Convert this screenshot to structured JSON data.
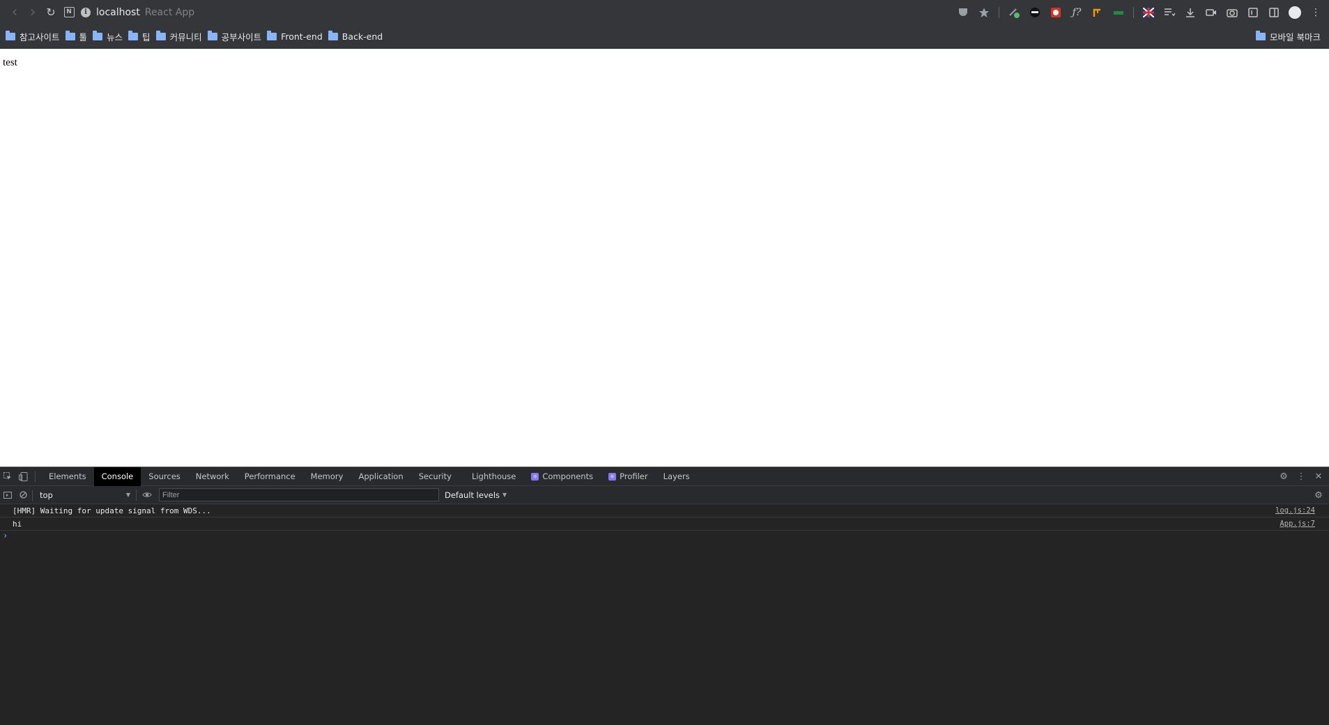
{
  "browser": {
    "nav": {
      "back_icon": "‹",
      "forward_icon": "›",
      "reload_icon": "↻",
      "ext_label": "N"
    },
    "omnibox": {
      "host": "localhost",
      "page_title": "React App",
      "info_glyph": "i"
    }
  },
  "bookmarks": {
    "items": [
      "참고사이트",
      "툴",
      "뉴스",
      "팁",
      "커뮤니티",
      "공부사이트",
      "Front-end",
      "Back-end"
    ],
    "mobile": "모바일 북마크"
  },
  "page": {
    "body_text": "test"
  },
  "devtools": {
    "tabs": [
      "Elements",
      "Console",
      "Sources",
      "Network",
      "Performance",
      "Memory",
      "Application",
      "Security",
      "Lighthouse",
      "Components",
      "Profiler",
      "Layers"
    ],
    "active_tab": "Console",
    "console": {
      "context": "top",
      "filter_placeholder": "Filter",
      "levels": "Default levels",
      "messages": [
        {
          "text": "[HMR] Waiting for update signal from WDS...",
          "source": "log.js:24"
        },
        {
          "text": "hi",
          "source": "App.js:7"
        }
      ],
      "prompt": "›"
    }
  },
  "colors": {
    "toolbar_bg": "#35363a",
    "devtools_bg": "#242424",
    "react_badge": "#8577f0",
    "prompt_blue": "#5c9dfa"
  }
}
